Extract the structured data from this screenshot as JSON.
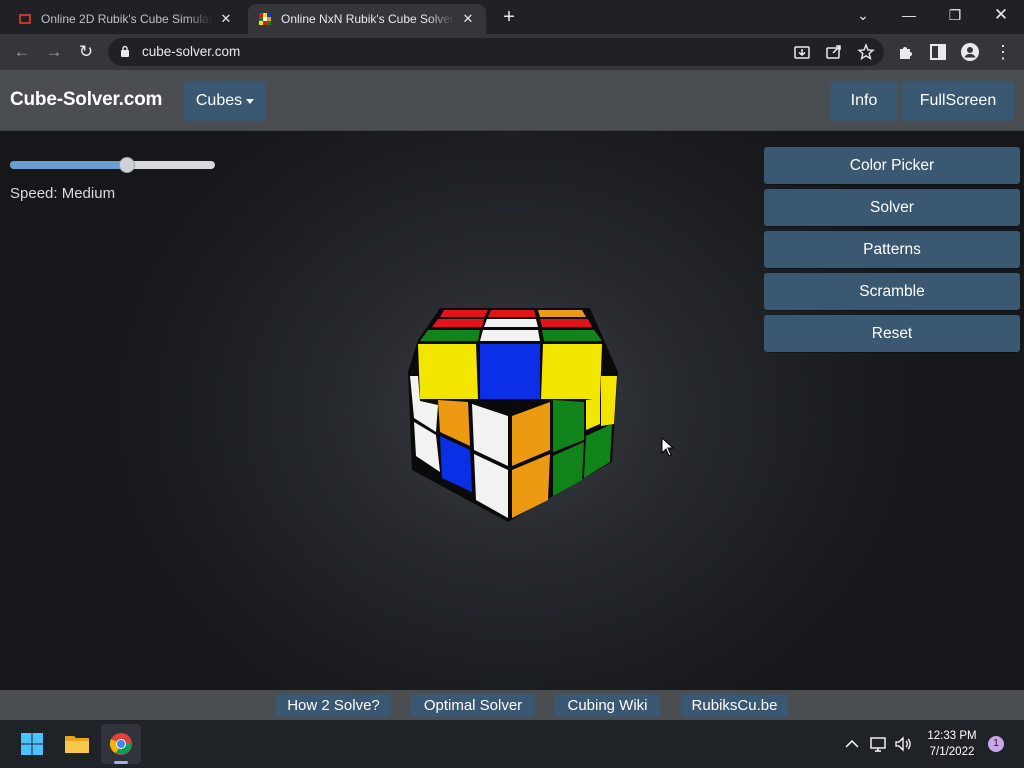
{
  "browser": {
    "tabs": [
      {
        "title": "Online 2D Rubik's Cube Simulator",
        "active": false
      },
      {
        "title": "Online NxN Rubik's Cube Solver",
        "active": true
      }
    ],
    "new_tab": "+",
    "url": "cube-solver.com"
  },
  "page": {
    "brand": "Cube-Solver.com",
    "cubes_menu": "Cubes",
    "info_button": "Info",
    "fullscreen_button": "FullScreen",
    "speed": {
      "label": "Speed: Medium",
      "value": 0.57
    },
    "side_buttons": [
      "Color Picker",
      "Solver",
      "Patterns",
      "Scramble",
      "Reset"
    ],
    "footer_links": [
      "How 2 Solve?",
      "Optimal Solver",
      "Cubing Wiki",
      "RubiksCu.be"
    ]
  },
  "taskbar": {
    "time": "12:33 PM",
    "date": "7/1/2022",
    "notifications": "1"
  },
  "colors": {
    "button_bg": "#3a5872",
    "navbar_bg": "#4a4d52",
    "cube_yellow": "#f2e600",
    "cube_blue": "#0a2fe6",
    "cube_white": "#f2f2f2",
    "cube_orange": "#eb9a12",
    "cube_green": "#10841a",
    "cube_red": "#e0141a"
  }
}
